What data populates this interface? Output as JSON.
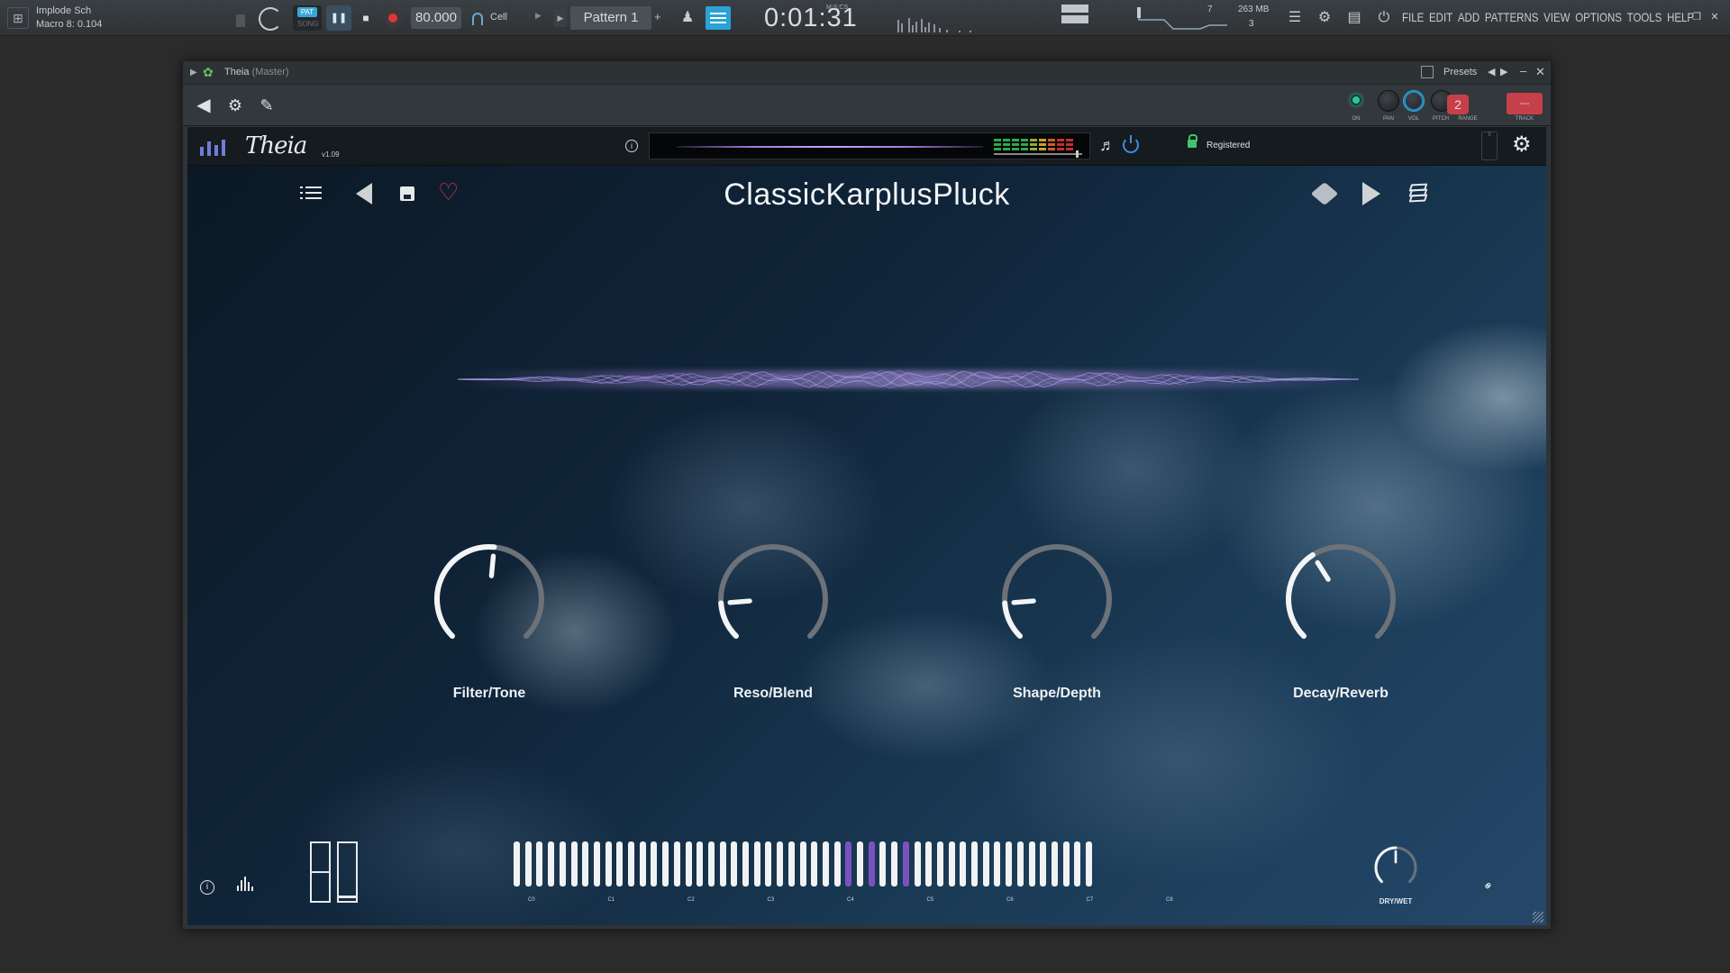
{
  "daw": {
    "hint_line1": "Implode Sch",
    "hint_line2": "Macro 8: 0.104",
    "pat_label": "PAT",
    "song_label": "SONG",
    "tempo": "80.000",
    "snap": "Cell",
    "pattern": "Pattern 1",
    "time": "0:01:31",
    "time_unit": "M:S:CS",
    "poly": "7",
    "ram": "263 MB",
    "ram_sub": "3",
    "menu": [
      "FILE",
      "EDIT",
      "ADD",
      "PATTERNS",
      "VIEW",
      "OPTIONS",
      "TOOLS",
      "HELP"
    ]
  },
  "wrapper": {
    "plugin_name": "Theia",
    "plugin_sub": "(Master)",
    "presets_label": "Presets",
    "labels": {
      "on": "ON",
      "pan": "PAN",
      "vol": "VOL",
      "pitch": "PITCH",
      "range": "RANGE",
      "track": "TRACK"
    },
    "pitch_value": "2",
    "track_value": "---"
  },
  "theia": {
    "wordmark": "Theia",
    "version": "v1.09",
    "registered": "Registered",
    "slot": "5",
    "preset_name": "ClassicKarplusPluck",
    "macros": [
      {
        "label": "Filter/Tone",
        "value": 0.52
      },
      {
        "label": "Reso/Blend",
        "value": 0.15
      },
      {
        "label": "Shape/Depth",
        "value": 0.15
      },
      {
        "label": "Decay/Reverb",
        "value": 0.38
      }
    ],
    "drywet_label": "DRY/WET",
    "drywet_value": 0.5,
    "octave_labels": [
      "C0",
      "C1",
      "C2",
      "C3",
      "C4",
      "C5",
      "C6",
      "C7",
      "C8"
    ],
    "active_keys": [
      29,
      31,
      34
    ]
  },
  "colors": {
    "accent_blue": "#2aa2d6",
    "pitch_red": "#c6404a",
    "fav_red": "#d63a48",
    "key_active": "#7a52c0",
    "on_green": "#28c89a"
  }
}
